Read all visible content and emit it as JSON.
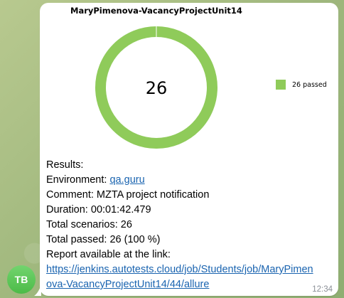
{
  "sender": {
    "initials": "TB",
    "avatar_color": "#5cc658"
  },
  "message": {
    "chart": {
      "title": "MaryPimenova-VacancyProjectUnit14",
      "center_value": "26",
      "legend_label": "26 passed",
      "passed_color": "#8fcb5a"
    },
    "chart_data": {
      "type": "pie",
      "title": "MaryPimenova-VacancyProjectUnit14",
      "categories": [
        "passed"
      ],
      "values": [
        26
      ],
      "legend": [
        "26 passed"
      ],
      "legend_placement": "right"
    },
    "results_heading": "Results:",
    "environment_label": "Environment:",
    "environment_link": "qa.guru",
    "comment_label": "Comment:",
    "comment_value": "MZTA project notification",
    "duration_label": "Duration:",
    "duration_value": "00:01:42.479",
    "scenarios_label": "Total scenarios:",
    "scenarios_value": "26",
    "passed_label": "Total passed:",
    "passed_value": "26 (100 %)",
    "report_label": "Report available at the link:",
    "report_link": "https://jenkins.autotests.cloud/job/Students/job/MaryPimenova-VacancyProjectUnit14/44/allure",
    "time": "12:34"
  }
}
